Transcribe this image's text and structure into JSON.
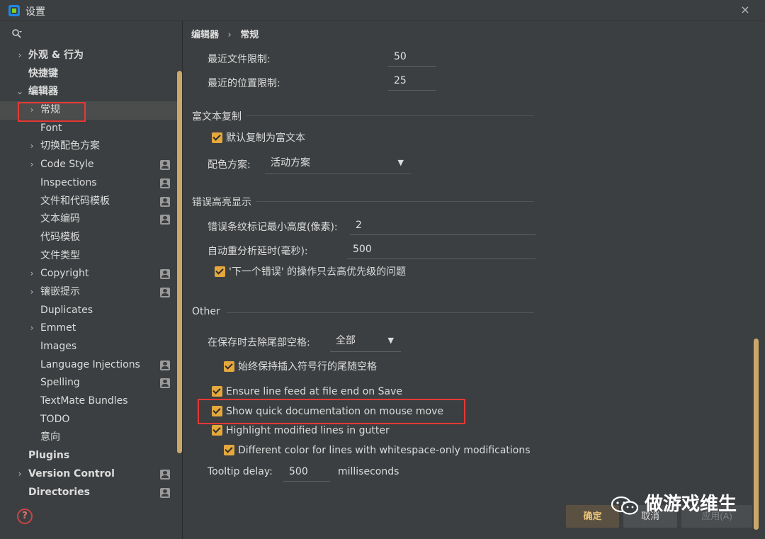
{
  "window": {
    "title": "设置",
    "close_glyph": "×"
  },
  "search": {
    "placeholder": ""
  },
  "breadcrumb": {
    "parent": "编辑器",
    "separator": "›",
    "current": "常规"
  },
  "tree": [
    {
      "label": "外观 & 行为",
      "level": 0,
      "chevron": "›",
      "bold": true,
      "badge": false
    },
    {
      "label": "快捷键",
      "level": 0,
      "chevron": "",
      "bold": true,
      "badge": false
    },
    {
      "label": "编辑器",
      "level": 0,
      "chevron": "⌄",
      "bold": true,
      "badge": false
    },
    {
      "label": "常规",
      "level": 1,
      "chevron": "›",
      "bold": false,
      "badge": false,
      "selected": true
    },
    {
      "label": "Font",
      "level": 1,
      "chevron": "",
      "bold": false,
      "badge": false
    },
    {
      "label": "切换配色方案",
      "level": 1,
      "chevron": "›",
      "bold": false,
      "badge": false
    },
    {
      "label": "Code Style",
      "level": 1,
      "chevron": "›",
      "bold": false,
      "badge": true
    },
    {
      "label": "Inspections",
      "level": 1,
      "chevron": "",
      "bold": false,
      "badge": true
    },
    {
      "label": "文件和代码模板",
      "level": 1,
      "chevron": "",
      "bold": false,
      "badge": true
    },
    {
      "label": "文本编码",
      "level": 1,
      "chevron": "",
      "bold": false,
      "badge": true
    },
    {
      "label": "代码模板",
      "level": 1,
      "chevron": "",
      "bold": false,
      "badge": false
    },
    {
      "label": "文件类型",
      "level": 1,
      "chevron": "",
      "bold": false,
      "badge": false
    },
    {
      "label": "Copyright",
      "level": 1,
      "chevron": "›",
      "bold": false,
      "badge": true
    },
    {
      "label": "镶嵌提示",
      "level": 1,
      "chevron": "›",
      "bold": false,
      "badge": true
    },
    {
      "label": "Duplicates",
      "level": 1,
      "chevron": "",
      "bold": false,
      "badge": false
    },
    {
      "label": "Emmet",
      "level": 1,
      "chevron": "›",
      "bold": false,
      "badge": false
    },
    {
      "label": "Images",
      "level": 1,
      "chevron": "",
      "bold": false,
      "badge": false
    },
    {
      "label": "Language Injections",
      "level": 1,
      "chevron": "",
      "bold": false,
      "badge": true
    },
    {
      "label": "Spelling",
      "level": 1,
      "chevron": "",
      "bold": false,
      "badge": true
    },
    {
      "label": "TextMate Bundles",
      "level": 1,
      "chevron": "",
      "bold": false,
      "badge": false
    },
    {
      "label": "TODO",
      "level": 1,
      "chevron": "",
      "bold": false,
      "badge": false
    },
    {
      "label": "意向",
      "level": 1,
      "chevron": "",
      "bold": false,
      "badge": false
    },
    {
      "label": "Plugins",
      "level": 0,
      "chevron": "",
      "bold": true,
      "badge": false
    },
    {
      "label": "Version Control",
      "level": 0,
      "chevron": "›",
      "bold": true,
      "badge": true
    },
    {
      "label": "Directories",
      "level": 0,
      "chevron": "",
      "bold": true,
      "badge": true
    }
  ],
  "recent": {
    "files_label": "最近文件限制:",
    "files_value": "50",
    "locations_label": "最近的位置限制:",
    "locations_value": "25"
  },
  "rich_copy": {
    "title": "富文本复制",
    "copy_as_rich_label": "默认复制为富文本",
    "scheme_label": "配色方案:",
    "scheme_value": "活动方案"
  },
  "error_highlight": {
    "title": "错误高亮显示",
    "min_height_label": "错误条纹标记最小高度(像素):",
    "min_height_value": "2",
    "reparse_label": "自动重分析延时(毫秒):",
    "reparse_value": "500",
    "next_error_label": "'下一个错误' 的操作只去高优先级的问题"
  },
  "other": {
    "title": "Other",
    "strip_label": "在保存时去除尾部空格:",
    "strip_value": "全部",
    "keep_caret_label": "始终保持插入符号行的尾随空格",
    "line_feed_label": "Ensure line feed at file end on Save",
    "quick_doc_label": "Show quick documentation on mouse move",
    "highlight_modified_label": "Highlight modified lines in gutter",
    "whitespace_color_label": "Different color for lines with whitespace-only modifications",
    "tooltip_label": "Tooltip delay:",
    "tooltip_value": "500",
    "tooltip_unit": "milliseconds"
  },
  "buttons": {
    "ok": "确定",
    "cancel": "取消",
    "apply": "应用(A)"
  },
  "help": {
    "glyph": "?"
  },
  "watermark": {
    "text": "做游戏维生"
  },
  "colors": {
    "accent": "#e4a83c",
    "highlight_box": "#e53935",
    "background": "#3c3f41"
  }
}
